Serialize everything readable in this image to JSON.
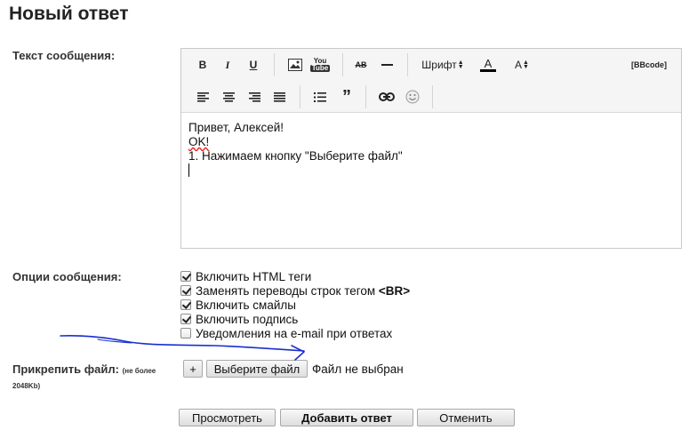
{
  "page": {
    "title": "Новый ответ"
  },
  "labels": {
    "message": "Текст сообщения:",
    "options": "Опции сообщения:",
    "attach": "Прикрепить файл:",
    "attach_limit_1": "(не более",
    "attach_limit_2": "2048Kb)"
  },
  "toolbar": {
    "bold": "B",
    "italic": "I",
    "underline": "U",
    "youtube_top": "You",
    "youtube_bottom": "Tube",
    "strike": "AB",
    "font": "Шрифт",
    "font_color": "A",
    "font_size": "A",
    "bbcode": "[BBcode]",
    "quote": "”"
  },
  "editor": {
    "lines": [
      "Привет, Алексей!",
      "OK!",
      "1. Нажимаем кнопку \"Выберите файл\""
    ]
  },
  "options": [
    {
      "label": "Включить HTML теги",
      "checked": true
    },
    {
      "label": "Заменять переводы строк тегом ",
      "bold_suffix": "<BR>",
      "checked": true
    },
    {
      "label": "Включить смайлы",
      "checked": true
    },
    {
      "label": "Включить подпись",
      "checked": true
    },
    {
      "label": "Уведомления на e-mail при ответах",
      "checked": false
    }
  ],
  "attach": {
    "plus_label": "+",
    "choose_label": "Выберите файл",
    "status": "Файл не выбран"
  },
  "actions": {
    "preview": "Просмотреть",
    "submit": "Добавить ответ",
    "cancel": "Отменить"
  },
  "colors": {
    "annotation": "#1a2fd0",
    "font_color_bar": "#000000"
  }
}
